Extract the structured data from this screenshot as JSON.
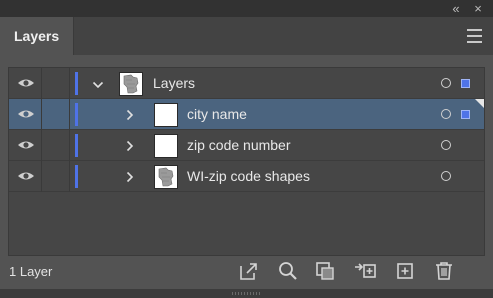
{
  "panel": {
    "tab_label": "Layers",
    "collapse_glyph": "«",
    "close_glyph": "×",
    "menu_icon": "hamburger-icon"
  },
  "colors": {
    "layer_color": "#4f73e7",
    "selected_row": "#4b647f",
    "panel_bg": "#535353"
  },
  "layers": [
    {
      "name": "Layers",
      "level": 0,
      "expanded": true,
      "selected": false,
      "thumbnail": "wisconsin-map",
      "selected_art": true
    },
    {
      "name": "city name",
      "level": 1,
      "expanded": false,
      "selected": true,
      "thumbnail": "blank",
      "selected_art": true
    },
    {
      "name": "zip code number",
      "level": 1,
      "expanded": false,
      "selected": false,
      "thumbnail": "blank",
      "selected_art": false
    },
    {
      "name": "WI-zip code shapes",
      "level": 1,
      "expanded": false,
      "selected": false,
      "thumbnail": "wisconsin-map",
      "selected_art": false
    }
  ],
  "footer": {
    "layer_count": "1 Layer",
    "buttons": [
      "export-icon",
      "search-icon",
      "clipping-mask-icon",
      "collect-icon",
      "new-sublayer-icon",
      "trash-icon"
    ]
  }
}
